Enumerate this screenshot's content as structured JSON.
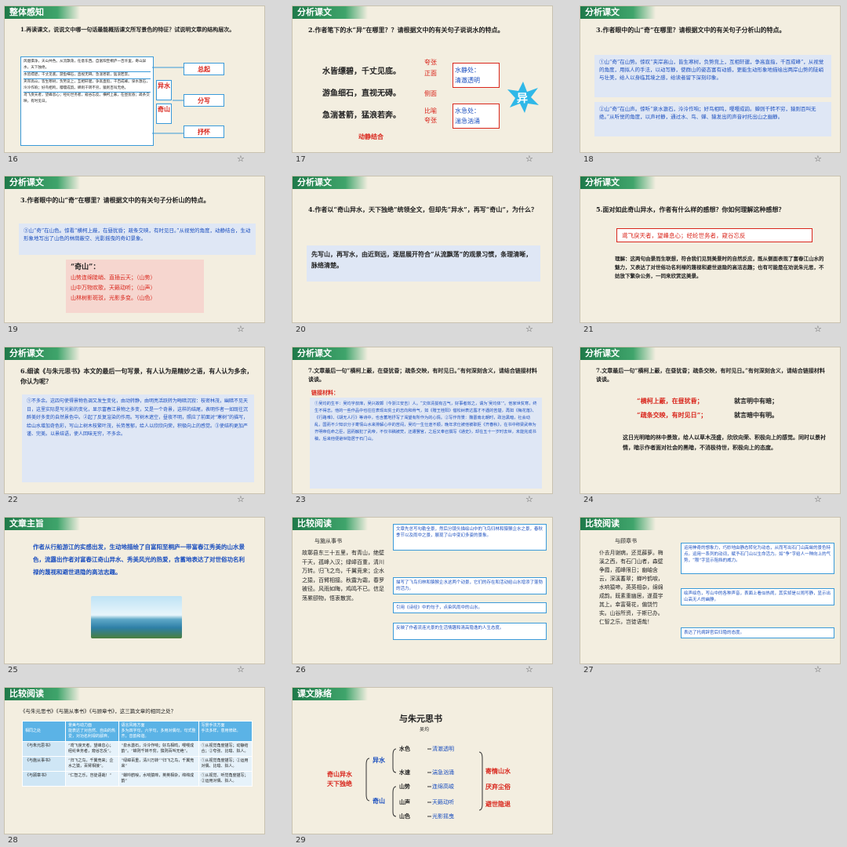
{
  "slides": [
    {
      "num": "16",
      "header": "整体感知",
      "question": "1.再读课文，说说文中哪一句话最能概括课文所写景色的特征？试说明文章的结构层次。",
      "left_lines": [
        "风烟俱净，天山共色。从流飘荡，任意东西。自富阳至桐庐一百许里，奇山异水，天下独绝。",
        "水皆缥碧，千丈见底。游鱼细石，直视无碍。急湍甚箭，猛浪若奔。",
        "夹岸高山，皆生寒树，负势竞上，互相轩邈，争高直指，千百成峰。泉水激石，泠泠作响；好鸟相鸣，嘤嘤成韵。蝉则千转不穷，猿则百叫无绝。",
        "鸢飞戾天者，望峰息心；经纶世务者，窥谷忘反。横柯上蔽，在昼犹昏；疏条交映，有时见日。"
      ],
      "mid": [
        "异水",
        "奇山"
      ],
      "right": [
        "总起",
        "分写",
        "抒怀"
      ]
    },
    {
      "num": "17",
      "header": "分析课文",
      "question": "2.作者笔下的水“异”在哪里？？请根据文中的有关句子说说水的特点。",
      "lines": [
        "水皆缥碧，千丈见底。",
        "游鱼细石，直视无碍。",
        "急湍甚箭，猛浪若奔。"
      ],
      "labels": [
        "夸张",
        "正面",
        "侧面",
        "比喻",
        "夸张"
      ],
      "static_box": [
        "水静处：",
        "清澈透明"
      ],
      "dynamic_box": [
        "水急处：",
        "湍急汹涌"
      ],
      "badge": "异",
      "bottom": "动静结合"
    },
    {
      "num": "18",
      "header": "分析课文",
      "question": "3.作者眼中的山“奇”在哪里？请根据文中的有关句子分析山的特点。",
      "box1": "①山“奇”在山势。惊叹“夹岸高山，皆生寒树，负势竞上，互相轩邈，争高直指，千百成峰”，从视觉的角度，用拟人的手法，以动写静，使群山的姿态富有动感，更能生动形象地描绘出两岸山势的陡峭与壮美，给人以身临其境之感，给读者留下深刻印象。",
      "box2": "②山“奇”在山声。惊听“泉水激石，泠泠作响；好鸟相鸣，嘤嘤成韵。蝉则千转不穷，猿则百叫无绝。”从听觉的角度，以声衬静，通过水、鸟、蝉、猿发出的声音衬托出山之幽静。"
    },
    {
      "num": "19",
      "header": "分析课文",
      "question": "3.作者眼中的山“奇”在哪里？请根据文中的有关句子分析山的特点。",
      "box1": "③山“奇”在山色。惊看“横柯上蔽，在昼犹昏；疏条交映，有时见日。”从视觉的角度，动静结合，生动形象地写出了山色的林荫蔽空、光影摇曳的奇幻景象。",
      "pink_title": "“奇山”：",
      "pink_lines": [
        "山势连绵陡峭、直插云天；（山势）",
        "山中万物欢歌，天籁动听；（山声）",
        "山林树影斑驳，光影多变。（山色）"
      ]
    },
    {
      "num": "20",
      "header": "分析课文",
      "question": "4.作者以“奇山异水，天下独绝”统领全文，但却先“异水”，再写“奇山”，为什么？",
      "answer": "先写山，再写水，由近到远，逐层展开符合“从流飘荡”的观景习惯，条理清晰，脉络清楚。"
    },
    {
      "num": "21",
      "header": "分析课文",
      "question": "5.面对如此奇山异水，作者有什么样的感想？你如何理解这种感想？",
      "quote": "鸢飞戾天者，望峰息心；经纶世务者，窥谷忘反",
      "answer": "理解：这两句由景而生联想，符合我们见到美景时的自然反应，既从侧面表现了富春江山水的魅力，又表达了对世俗功名利禄的蔑视和避世退隐的高洁志趣；也有可能是在劝说朱元思，不妨放下繁杂公务，一同来欣赏这美景。"
    },
    {
      "num": "22",
      "header": "分析课文",
      "question": "6.细读《与朱元思书》本文的最后一句写景，有人认为是精妙之语，有人认为多余，你认为呢？",
      "answer": "①不多余。这四句使得景物色调又发生变化，由动转静，由明亮活跃转为晦暗沉寂：枝密林茂，幽暗不见天日，这里实际是写光影的变化，显示富春江景物之多变，又是一个奇景，这样的结尾，表明作者一如既往沉醉美好多变的自然景色中。②起了反复渲染的作用。写树木遮空，昼夜不明，照应了前面对“寒树”的描写，给山水增加奇色彩，写山上树木枝繁叶茂，长势葱郁，给人以欣欣向荣，积极向上的感觉。③使结构更加严谨、完美。以景结语，使人回味无穷，不多余。"
    },
    {
      "num": "23",
      "header": "分析课文",
      "question": "7.文章最后一句“横柯上蔽，在昼犹昏；疏条交映，有时见日。”有何深刻含义，请结合链接材料谈谈。",
      "link_title": "链接材料：",
      "link_text": "①吴均的生平：吴均字叔庠，吴兴故鄣（今浙江安吉）人。“文体清拔有古气，好事者效之，谓为‘吴均体’”。他家世贫寒，终生不得志。他的一些作品中也往往表现出贫士的志向和骨气，如《赠王桂阳》借松树表达露才不遇的苦楚，再如《梅花落》、《行路难》、《胡无人行》等诗中，也含蓄地抒写了渴望有所作为的心情。②写作背景：魏晋南北朝时，政治黑暗，社会动乱，国而不少知识分子寄情山水来排解心中的苦闷，吴均一生仕途不顺，晚年求仕被他被职拒《齐春秋》，在书中称梁武帝为齐明帝佐命之臣，因而触犯了武帝，不仅书稿被焚，还遭罢官，之后又奉召撰写《通史》，却在五十一岁时去世，未能完成书稿，后来他便避世隐居于石门山。"
    },
    {
      "num": "24",
      "header": "分析课文",
      "question": "7.文章最后一句“横柯上蔽，在昼犹昏；疏条交映，有时见日。”有何深刻含义，请结合链接材料谈谈。",
      "red1": "“横柯上蔽，在昼犹昏；",
      "red1b": "就言明中有暗；",
      "red2": "“疏条交映，有时见日”；",
      "red2b": "就言暗中有明。",
      "answer": "这日光明暗的林中景致，给人以草木茂盛，欣欣向荣、积极向上的感觉。同时以景衬情，暗示作者面对社会的黑暗，不消极待世，积极向上的态度。"
    },
    {
      "num": "25",
      "header": "文章主旨",
      "text": "作者从行船游江的实感出发，生动地描绘了自富阳至桐庐一带富春江秀美的山水景色，流露出作者对富春江奇山异水、秀美风光的热爱，含蓄地表达了对世俗功名利禄的蔑视和避世退隐的高洁志趣。"
    },
    {
      "num": "26",
      "header": "比较阅读",
      "title": "与施从事书",
      "body": "故鄣县东三十五里，有青山，绝壁干天，孤峰入汉；绿嶂百重，清川万转。归飞之鸟，千翼竞来；企水之猿，百臂相接。秋露为霜，春罗被径。风雨如晦，鸡鸣不已。信足荡累颐物，悟衷散赏。",
      "notes": [
        "文章先总写勾勒全景，然后分镜头描绘山中的飞鸟归林和猿猴企水之景，春秋季节以及雨中之景，展现了山中变幻多姿的景象。",
        "描写了飞鸟归林和猿猴企水这两个动景，它们的存在和活动给山水增添了蓬勃的活力。",
        "引用《诗经》中的句子，点染风雨中的山水。",
        "反映了作者流连光景的生活情趣和清高隐逸的人生态度。"
      ]
    },
    {
      "num": "27",
      "header": "比较阅读",
      "title": "与顾章书",
      "body": "仆去月谢病，还觅薜萝。梅溪之西，有石门山者，森壁争霞，孤峰限日；幽岫含云，深溪蓄翠；蝉吟鹤唳，水响猿啼，英英相杂，绵绵成韵。既素重幽居，遂葺宇其上。幸富菊花，偏饶竹实。山谷所资，于斯已办。仁智之乐，岂徒语哉！",
      "notes": [
        "运用神奇的想象力，巧妙地由静态转化为动态，从而写出石门山高耸的景色特点。运用一系列的动词，赋予石门山以生命活力。如“争”字给人一种向上的气势，“限”字显示阻挡的威力。",
        "绘声绘色，写山中的各种声音，表面上看似热闹，其实却是以闹写静，显示出山高无人的幽静。",
        "表达了托病辞官后归隐的态度。"
      ]
    },
    {
      "num": "28",
      "header": "比较阅读",
      "question": "《与朱元思书》《与施从事书》《与顾章书》，这三篇文章的相同之处？",
      "col_heads": [
        "相同之处",
        "景美与动力面",
        "语言风格方面",
        "写景手法方面"
      ],
      "row_head_notes": [
        "能表达了对自然、自由的热爱，对功名利禄的鄙弃。",
        "多为四字句，六字句，多用对偶句，句式整齐，音韵和谐。",
        "手法多样，意用修辞。"
      ],
      "rows": [
        [
          "《与朱元思书》",
          "“鸢飞戾天者，望峰息心；经纶世务者，窥谷忘反”。",
          "“泉水激石，泠泠作响；好鸟相鸣，嘤嘤成韵”。“蝉则千转不穷，猿则百叫无绝”。",
          "①从视觉角度描写；动静结合；②夸张、比喻、拟人。"
        ],
        [
          "《与施从事书》",
          "“归飞之鸟，千翼竞来；企水之猿，百臂相接”。",
          "“绿嶂百重，清川万转”“归飞之鸟，千翼竞来”",
          "①从视觉角度描写；②运用对偶、比喻、拟人。"
        ],
        [
          "《与顾章书》",
          "“仁智之乐，岂徒语哉！”",
          "“蝉吟鹤唳，水响猿啼，英英相杂，绵绵成韵”",
          "①从视觉、听觉角度描写；②运用对偶、拟人。"
        ]
      ]
    },
    {
      "num": "29",
      "header": "课文脉络",
      "title": "与朱元思书",
      "author": "吴均",
      "root": [
        "奇山异水",
        "天下独绝"
      ],
      "branches": [
        "异水",
        "奇山"
      ],
      "items": [
        [
          "水色",
          "清澈透明"
        ],
        [
          "水速",
          "湍急汹涌"
        ],
        [
          "山势",
          "连绵高峻"
        ],
        [
          "山声",
          "天籁动听"
        ],
        [
          "山色",
          "光影摇曳"
        ]
      ],
      "outcomes": [
        "寄情山水",
        "厌弃尘俗",
        "避世隐退"
      ]
    }
  ]
}
